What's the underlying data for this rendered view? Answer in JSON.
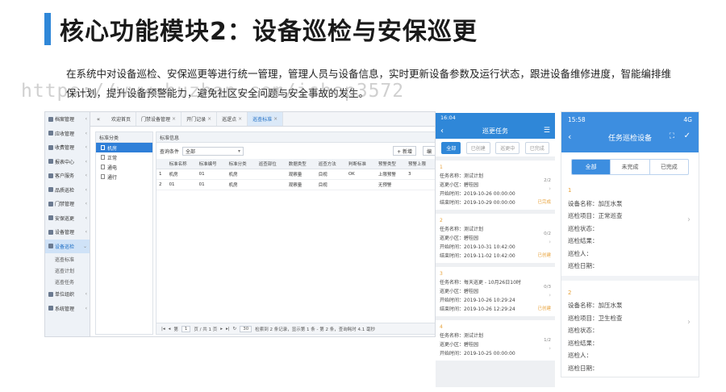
{
  "slide": {
    "title": "核心功能模块2：设备巡检与安保巡更",
    "description": "在系统中对设备巡检、安保巡更等进行统一管理，管理人员与设备信息，实时更新设备参数及运行状态，跟进设备维修进度，智能编排维保计划，提升设备预警能力，避免社区安全问题与安全事故的发生。",
    "watermark": "https://www.huzhan.com/ishop3572"
  },
  "desktop": {
    "sidebar": {
      "items": [
        {
          "label": "档案管理",
          "icon": "folder-icon"
        },
        {
          "label": "应收管理",
          "icon": "list-icon"
        },
        {
          "label": "收费管理",
          "icon": "coin-icon"
        },
        {
          "label": "报表中心",
          "icon": "chart-icon"
        },
        {
          "label": "客户服务",
          "icon": "headset-icon"
        },
        {
          "label": "品质巡检",
          "icon": "check-icon"
        },
        {
          "label": "门禁管理",
          "icon": "door-icon"
        },
        {
          "label": "安保巡更",
          "icon": "shield-icon"
        },
        {
          "label": "设备管理",
          "icon": "wrench-icon"
        },
        {
          "label": "设备巡检",
          "icon": "gear-icon",
          "active": true
        }
      ],
      "subitems": [
        "巡查标准",
        "巡查计划",
        "巡查任务"
      ],
      "bottom_items": [
        {
          "label": "单位组织",
          "icon": "org-icon"
        },
        {
          "label": "系统管理",
          "icon": "settings-icon"
        }
      ]
    },
    "tabs": [
      {
        "label": "欢迎首页",
        "closable": false
      },
      {
        "label": "门禁设备管理",
        "closable": true
      },
      {
        "label": "开门记录",
        "closable": true
      },
      {
        "label": "巡逻点",
        "closable": true
      },
      {
        "label": "巡查标准",
        "closable": true,
        "active": true
      }
    ],
    "tree": {
      "title": "标准分类",
      "items": [
        {
          "label": "机房",
          "active": true
        },
        {
          "label": "正常"
        },
        {
          "label": "通电"
        },
        {
          "label": "通行"
        }
      ]
    },
    "grid": {
      "title": "标准信息",
      "filter_label": "查询条件",
      "filter_value": "全部",
      "add_label": "+ 新增",
      "edit_label": "编",
      "columns": [
        "",
        "标准名称",
        "标准编号",
        "标准分类",
        "巡查部位",
        "数据类型",
        "巡查方法",
        "判断标准",
        "预警类型",
        "预警上限"
      ],
      "rows": [
        [
          "1",
          "机房",
          "01",
          "机房",
          "",
          "观察量",
          "目视",
          "OK",
          "上限预警",
          "3"
        ],
        [
          "2",
          "01",
          "01",
          "机房",
          "",
          "观察量",
          "目视",
          "",
          "无预警",
          ""
        ]
      ],
      "pager": {
        "page_label": "第",
        "page_value": "1",
        "page_total": "页 / 共 1 页",
        "page_size": "30",
        "summary": "检索到 2 条记录，显示第 1 条 - 第 2 条，查询耗时 4.1 毫秒"
      }
    }
  },
  "phone1": {
    "time": "16:04",
    "title": "巡更任务",
    "filters": [
      "全部",
      "已创建",
      "巡更中",
      "已完成"
    ],
    "active_filter": 0,
    "cards": [
      {
        "index": "1",
        "name": "任务名称：测试计划",
        "area": "巡更小区：碧桂园",
        "start": "开始时间：2019-10-26 00:00:00",
        "end": "结束时间：2019-10-29 00:00:00",
        "count": "2/2",
        "status": "已完成"
      },
      {
        "index": "2",
        "name": "任务名称：测试计划",
        "area": "巡更小区：碧桂园",
        "start": "开始时间：2019-10-31 10:42:00",
        "end": "结束时间：2019-11-02 10:42:00",
        "count": "0/2",
        "status": "已创建"
      },
      {
        "index": "3",
        "name": "任务名称：每天巡更 - 10月26日10时",
        "area": "巡更小区：碧桂园",
        "start": "开始时间：2019-10-26 10:29:24",
        "end": "结束时间：2019-10-26 12:29:24",
        "count": "0/3",
        "status": "已创建"
      },
      {
        "index": "4",
        "name": "任务名称：测试计划",
        "area": "巡更小区：碧桂园",
        "start": "开始时间：2019-10-25 00:00:00",
        "end": "",
        "count": "1/2",
        "status": ""
      }
    ]
  },
  "phone2": {
    "time": "15:58",
    "signal": "4G",
    "title": "任务巡检设备",
    "tabs": [
      "全部",
      "未完成",
      "已完成"
    ],
    "active_tab": 0,
    "sections": [
      {
        "index": "1",
        "rows": [
          "设备名称：加压水泵",
          "巡检项目：正常巡查",
          "巡检状态：",
          "巡检结果：",
          "巡检人：",
          "巡检日期："
        ]
      },
      {
        "index": "2",
        "rows": [
          "设备名称：加压水泵",
          "巡检项目：卫生检查",
          "巡检状态：",
          "巡检结果：",
          "巡检人：",
          "巡检日期："
        ]
      }
    ]
  }
}
